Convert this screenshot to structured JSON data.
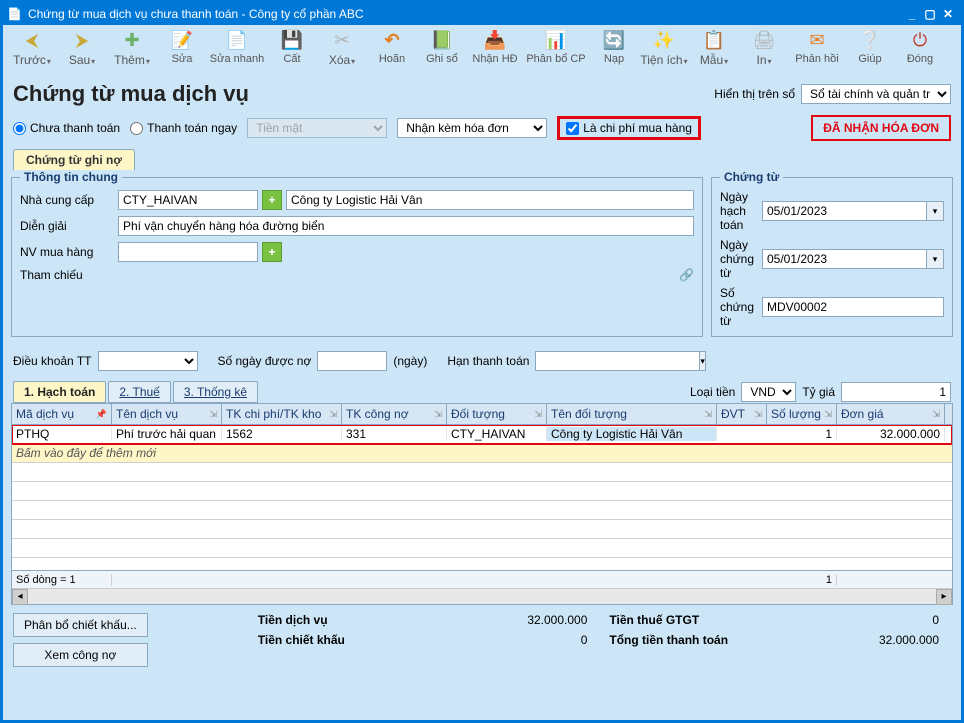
{
  "window": {
    "title": "Chứng từ mua dịch vụ chưa thanh toán - Công ty cổ phần ABC",
    "min": "_",
    "max": "▢",
    "close": "✕"
  },
  "toolbar": {
    "truoc": "Trước",
    "sau": "Sau",
    "them": "Thêm",
    "sua": "Sửa",
    "suanhanh": "Sửa nhanh",
    "cat": "Cất",
    "xoa": "Xóa",
    "hoan": "Hoãn",
    "ghiso": "Ghi sổ",
    "nhanhd": "Nhận HĐ",
    "phanbocp": "Phân bổ CP",
    "nap": "Nạp",
    "tienich": "Tiện ích",
    "mau": "Mẫu",
    "in": "In",
    "phanhoi": "Phản hồi",
    "giup": "Giúp",
    "dong": "Đóng"
  },
  "page_title": "Chứng từ mua dịch vụ",
  "display_on": {
    "label": "Hiển thị trên sổ",
    "value": "Sổ tài chính và quản trị"
  },
  "options": {
    "chua_tt": "Chưa thanh toán",
    "tt_ngay": "Thanh toán ngay",
    "payment_method": "Tiền mặt",
    "invoice_mode": "Nhận kèm hóa đơn",
    "is_purchase_cost": "Là chi phí mua hàng",
    "got_invoice": "ĐÃ NHẬN HÓA ĐƠN"
  },
  "tab_ghino": "Chứng từ ghi nợ",
  "general": {
    "legend": "Thông tin chung",
    "supplier_lbl": "Nhà cung cấp",
    "supplier_code": "CTY_HAIVAN",
    "supplier_name": "Công ty Logistic Hải Vân",
    "desc_lbl": "Diễn giải",
    "desc": "Phí vận chuyển hàng hóa đường biển",
    "buyer_lbl": "NV mua hàng",
    "buyer": "",
    "ref_lbl": "Tham chiếu"
  },
  "voucher": {
    "legend": "Chứng từ",
    "date_acc_lbl": "Ngày hạch toán",
    "date_acc": "05/01/2023",
    "date_doc_lbl": "Ngày chứng từ",
    "date_doc": "05/01/2023",
    "no_lbl": "Số chứng từ",
    "no": "MDV00002"
  },
  "terms": {
    "term_lbl": "Điều khoản TT",
    "term": "",
    "days_lbl": "Số ngày được nợ",
    "days": "",
    "days_unit": "(ngày)",
    "due_lbl": "Hạn thanh toán",
    "due": ""
  },
  "subtabs": {
    "t1": "1. Hạch toán",
    "t2": "2. Thuế",
    "t3": "3. Thống kê"
  },
  "currency": {
    "label": "Loại tiền",
    "value": "VND",
    "rate_lbl": "Tỷ giá",
    "rate": "1"
  },
  "grid": {
    "headers": {
      "code": "Mã dịch vụ",
      "name": "Tên dịch vụ",
      "exp_acct": "TK chi phí/TK kho",
      "debt_acct": "TK công nợ",
      "obj": "Đối tượng",
      "obj_name": "Tên đối tượng",
      "unit": "ĐVT",
      "qty": "Số lượng",
      "price": "Đơn giá"
    },
    "rows": [
      {
        "code": "PTHQ",
        "name": "Phí trước hải quan",
        "exp_acct": "1562",
        "debt_acct": "331",
        "obj": "CTY_HAIVAN",
        "obj_name": "Công ty Logistic Hải Vân",
        "unit": "",
        "qty": "1",
        "price": "32.000.000"
      }
    ],
    "addrow": "Bấm vào đây để thêm mới",
    "footer": {
      "count": "Số dòng = 1",
      "qty_sum": "1"
    }
  },
  "actions": {
    "discount": "Phân bổ chiết khấu...",
    "viewdebt": "Xem công nợ"
  },
  "totals": {
    "service_lbl": "Tiền dịch vụ",
    "service": "32.000.000",
    "vat_lbl": "Tiền thuế GTGT",
    "vat": "0",
    "discount_lbl": "Tiền chiết khấu",
    "discount": "0",
    "total_lbl": "Tổng tiền thanh toán",
    "total": "32.000.000"
  }
}
